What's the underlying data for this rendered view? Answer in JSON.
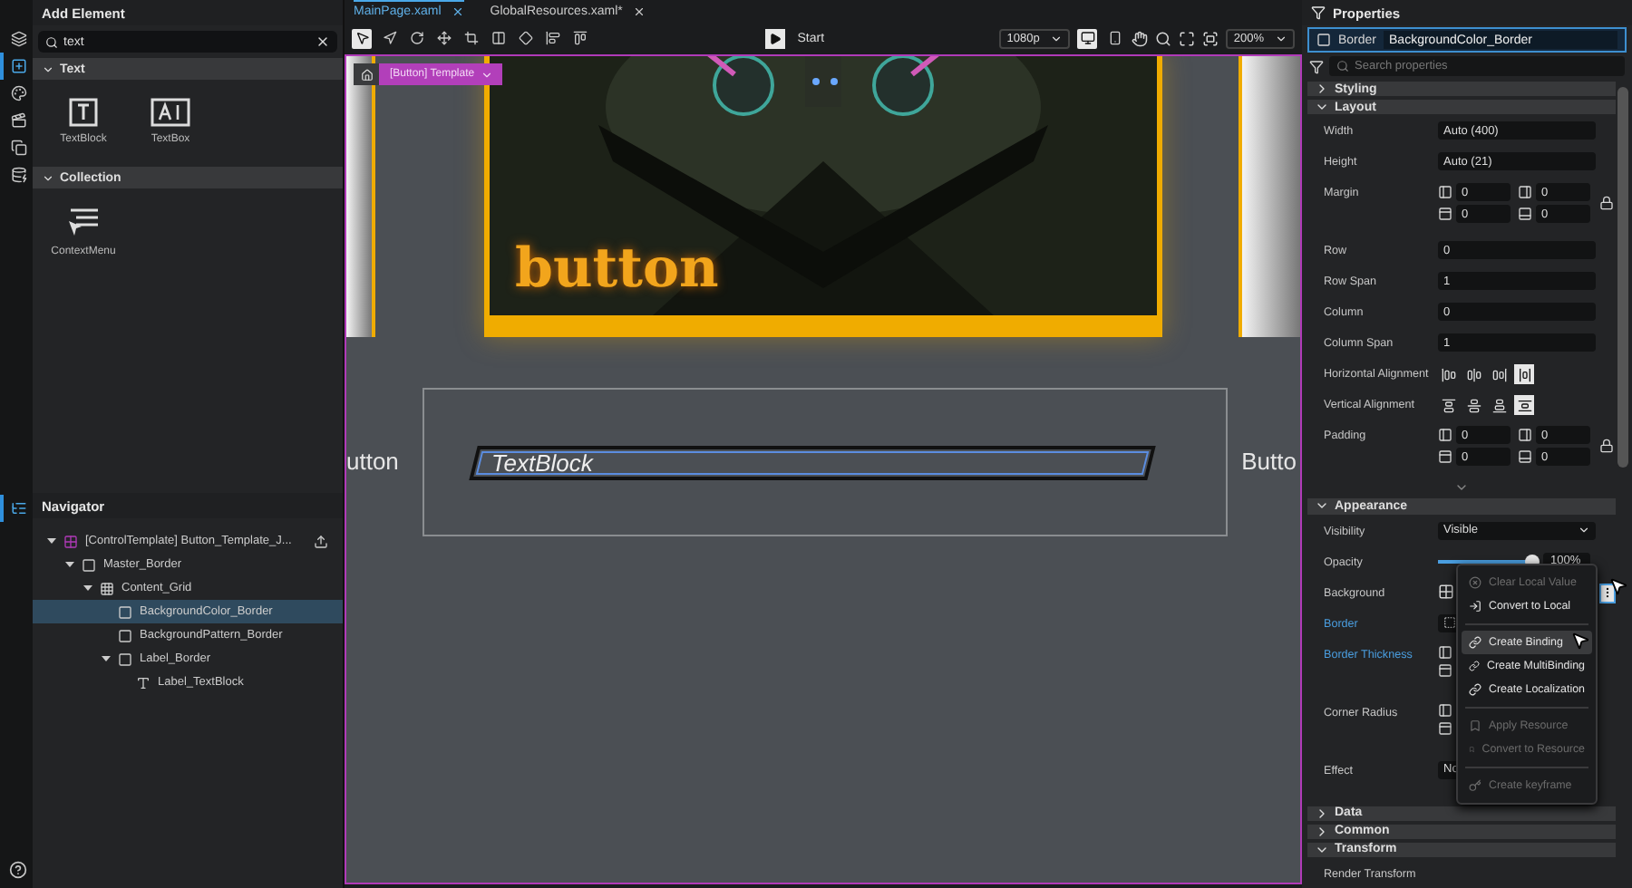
{
  "rail": {
    "top": [
      {
        "kind": "layers",
        "selected": false
      },
      {
        "kind": "add",
        "selected": true
      },
      {
        "kind": "palette",
        "selected": false
      },
      {
        "kind": "media",
        "selected": false
      },
      {
        "kind": "copy",
        "selected": false
      },
      {
        "kind": "data",
        "selected": false
      }
    ],
    "navigator": {
      "kind": "tree",
      "selected": true
    },
    "help": {
      "kind": "help",
      "selected": false
    }
  },
  "add_element": {
    "title": "Add Element",
    "search": {
      "value": "text"
    },
    "sections": [
      {
        "title": "Text",
        "expanded": true,
        "items": [
          {
            "label": "TextBlock",
            "kind": "textblock"
          },
          {
            "label": "TextBox",
            "kind": "textbox"
          }
        ]
      },
      {
        "title": "Collection",
        "expanded": true,
        "items": [
          {
            "label": "ContextMenu",
            "kind": "menu"
          }
        ]
      }
    ]
  },
  "navigator": {
    "title": "Navigator",
    "tree": [
      {
        "label": "[ControlTemplate] Button_Template_J...",
        "kind": "template",
        "expanded": true,
        "selected": false,
        "children": [
          {
            "label": "Master_Border",
            "kind": "border",
            "expanded": true,
            "selected": false,
            "children": [
              {
                "label": "Content_Grid",
                "kind": "grid",
                "expanded": true,
                "selected": false,
                "children": [
                  {
                    "label": "BackgroundColor_Border",
                    "kind": "border",
                    "selected": true
                  },
                  {
                    "label": "BackgroundPattern_Border",
                    "kind": "border",
                    "selected": false
                  },
                  {
                    "label": "Label_Border",
                    "kind": "border",
                    "expanded": true,
                    "selected": false,
                    "children": [
                      {
                        "label": "Label_TextBlock",
                        "kind": "text",
                        "selected": false
                      }
                    ]
                  }
                ]
              }
            ]
          }
        ]
      }
    ]
  },
  "editor": {
    "tabs": [
      {
        "label": "MainPage.xaml",
        "selected": true
      },
      {
        "label": "GlobalResources.xaml*",
        "selected": false
      }
    ],
    "tools": [
      {
        "kind": "select",
        "selected": true
      },
      {
        "kind": "direct",
        "selected": false
      },
      {
        "kind": "rotate",
        "selected": false
      },
      {
        "kind": "move",
        "selected": false
      },
      {
        "kind": "crop",
        "selected": false
      },
      {
        "kind": "split",
        "selected": false
      },
      {
        "kind": "diamond",
        "selected": false
      },
      {
        "kind": "align-left",
        "selected": false
      },
      {
        "kind": "align-top",
        "selected": false
      }
    ],
    "start": "Start",
    "resolution": "1080p",
    "views": [
      {
        "kind": "desktop",
        "selected": true
      },
      {
        "kind": "phone",
        "selected": false
      }
    ],
    "zoom": "200%",
    "breadcrumb": "[Button] Template",
    "canvas": {
      "card_text": "button",
      "left_text": "utton",
      "right_text": "Butto",
      "textblock": "TextBlock"
    }
  },
  "properties": {
    "title": "Properties",
    "element_type": "Border",
    "element_name": "BackgroundColor_Border",
    "search": {
      "placeholder": "Search properties"
    },
    "sections": [
      {
        "title": "Styling",
        "expanded": false
      },
      {
        "title": "Layout",
        "expanded": true,
        "rows": [
          {
            "kind": "text",
            "label": "Width",
            "value": "Auto (400)"
          },
          {
            "kind": "text",
            "label": "Height",
            "value": "Auto (21)"
          },
          {
            "kind": "quad",
            "label": "Margin",
            "values": [
              "0",
              "0",
              "0",
              "0"
            ]
          },
          {
            "kind": "text",
            "label": "Row",
            "value": "0"
          },
          {
            "kind": "text",
            "label": "Row Span",
            "value": "1"
          },
          {
            "kind": "text",
            "label": "Column",
            "value": "0"
          },
          {
            "kind": "text",
            "label": "Column Span",
            "value": "1"
          },
          {
            "kind": "halign",
            "label": "Horizontal Alignment",
            "options": [
              {
                "selected": false
              },
              {
                "selected": false
              },
              {
                "selected": false
              },
              {
                "selected": true
              }
            ]
          },
          {
            "kind": "valign",
            "label": "Vertical Alignment",
            "options": [
              {
                "selected": false
              },
              {
                "selected": false
              },
              {
                "selected": false
              },
              {
                "selected": true
              }
            ]
          },
          {
            "kind": "quad",
            "label": "Padding",
            "values": [
              "0",
              "0",
              "0",
              "0"
            ]
          },
          {
            "kind": "more"
          }
        ]
      },
      {
        "title": "Appearance",
        "expanded": true,
        "rows": [
          {
            "kind": "dropdown",
            "label": "Visibility",
            "value": "Visible"
          },
          {
            "kind": "slider",
            "label": "Opacity",
            "level": 1,
            "reading": "100%"
          },
          {
            "kind": "brush",
            "label": "Background",
            "highlighted": false
          },
          {
            "kind": "color",
            "label": "Border",
            "highlighted": true
          },
          {
            "kind": "quad",
            "label": "Border Thickness",
            "highlighted": true
          },
          {
            "kind": "quad",
            "label": "Corner Radius",
            "highlighted": false
          },
          {
            "kind": "text",
            "label": "Effect",
            "value": "No"
          }
        ]
      },
      {
        "title": "Data",
        "expanded": false
      },
      {
        "title": "Common",
        "expanded": false
      },
      {
        "title": "Transform",
        "expanded": true,
        "rows": [
          {
            "kind": "label",
            "label": "Render Transform"
          }
        ]
      }
    ]
  },
  "context_menu": {
    "items": [
      {
        "kind": "clear",
        "label": "Clear Local Value",
        "disabled": true,
        "selected": false
      },
      {
        "kind": "local",
        "label": "Convert to Local",
        "disabled": false,
        "selected": false
      },
      {
        "kind": "separator"
      },
      {
        "kind": "binding",
        "label": "Create Binding",
        "disabled": false,
        "selected": true
      },
      {
        "kind": "binding",
        "label": "Create MultiBinding",
        "disabled": false,
        "selected": false
      },
      {
        "kind": "binding",
        "label": "Create Localization",
        "disabled": false,
        "selected": false
      },
      {
        "kind": "separator"
      },
      {
        "kind": "resource",
        "label": "Apply Resource",
        "disabled": true,
        "selected": false
      },
      {
        "kind": "resource",
        "label": "Convert to Resource",
        "disabled": true,
        "selected": false
      },
      {
        "kind": "separator"
      },
      {
        "kind": "key",
        "label": "Create keyframe",
        "disabled": true,
        "selected": false
      }
    ]
  }
}
